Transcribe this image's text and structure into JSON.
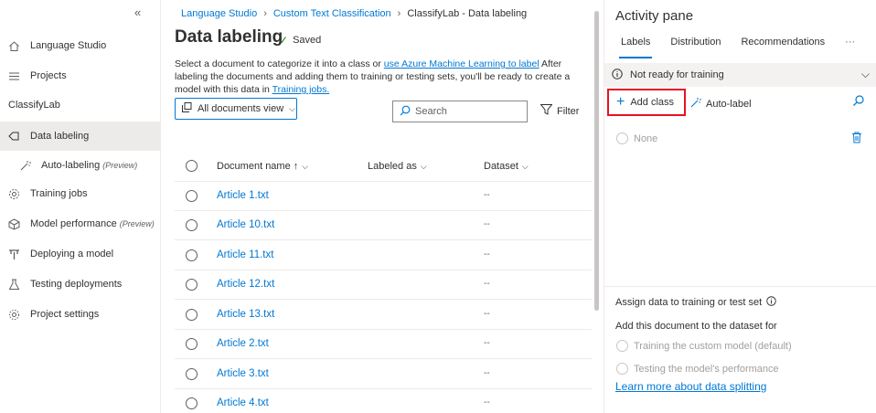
{
  "sidebar": {
    "collapse_icon": "«",
    "top_items": [
      {
        "label": "Language Studio",
        "icon": "home-icon"
      },
      {
        "label": "Projects",
        "icon": "list-icon"
      }
    ],
    "project_name": "ClassifyLab",
    "items": [
      {
        "label": "Data labeling",
        "icon": "tag-icon",
        "active": true
      },
      {
        "label": "Auto-labeling",
        "preview": "(Preview)",
        "icon": "wand-icon"
      },
      {
        "label": "Training jobs",
        "icon": "gear-icon"
      },
      {
        "label": "Model performance",
        "preview": "(Preview)",
        "icon": "cube-icon"
      },
      {
        "label": "Deploying a model",
        "icon": "deploy-icon"
      },
      {
        "label": "Testing deployments",
        "icon": "flask-icon"
      },
      {
        "label": "Project settings",
        "icon": "settings-icon"
      }
    ]
  },
  "breadcrumb": [
    "Language Studio",
    "Custom Text Classification",
    "ClassifyLab - Data labeling"
  ],
  "page": {
    "title": "Data labeling",
    "saved": "Saved",
    "desc_part1": "Select a document to categorize it into a class or ",
    "desc_link1": "use Azure Machine Learning to label",
    "desc_part2": "  After labeling the documents and adding them to training or testing sets, you'll be ready to create a model with this data in ",
    "desc_link2": "Training jobs.",
    "view_button": "All documents view",
    "search_placeholder": "Search",
    "filter": "Filter"
  },
  "table": {
    "columns": [
      "Document name ↑",
      "Labeled as",
      "Dataset"
    ],
    "rows": [
      {
        "name": "Article 1.txt",
        "dataset": "--"
      },
      {
        "name": "Article 10.txt",
        "dataset": "--"
      },
      {
        "name": "Article 11.txt",
        "dataset": "--"
      },
      {
        "name": "Article 12.txt",
        "dataset": "--"
      },
      {
        "name": "Article 13.txt",
        "dataset": "--"
      },
      {
        "name": "Article 2.txt",
        "dataset": "--"
      },
      {
        "name": "Article 3.txt",
        "dataset": "--"
      },
      {
        "name": "Article 4.txt",
        "dataset": "--"
      }
    ]
  },
  "pane": {
    "title": "Activity pane",
    "tabs": [
      "Labels",
      "Distribution",
      "Recommendations"
    ],
    "more": "···",
    "status": "Not ready for training",
    "add_class": "Add class",
    "auto_label": "Auto-label",
    "none_label": "None",
    "assign_title": "Assign data to training or test set",
    "add_doc": "Add this document to the dataset for",
    "opt_training": "Training the custom model (default)",
    "opt_testing": "Testing the model's performance",
    "learn_more": "Learn more about data splitting"
  },
  "colors": {
    "accent": "#0078d4",
    "highlight": "#e81123",
    "saved_check": "#107c10"
  }
}
